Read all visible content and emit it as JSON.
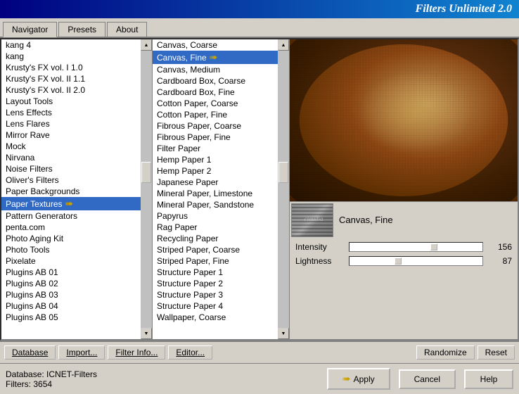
{
  "title": "Filters Unlimited 2.0",
  "tabs": [
    {
      "id": "navigator",
      "label": "Navigator",
      "active": true
    },
    {
      "id": "presets",
      "label": "Presets",
      "active": false
    },
    {
      "id": "about",
      "label": "About",
      "active": false
    }
  ],
  "left_list": {
    "items": [
      "kang 4",
      "kang",
      "Krusty's FX vol. I 1.0",
      "Krusty's FX vol. II 1.1",
      "Krusty's FX vol. II 2.0",
      "Layout Tools",
      "Lens Effects",
      "Lens Flares",
      "Mirror Rave",
      "Mock",
      "Nirvana",
      "Noise Filters",
      "Oliver's Filters",
      "Paper Backgrounds",
      "Paper Textures",
      "Pattern Generators",
      "penta.com",
      "Photo Aging Kit",
      "Photo Tools",
      "Pixelate",
      "Plugins AB 01",
      "Plugins AB 02",
      "Plugins AB 03",
      "Plugins AB 04",
      "Plugins AB 05"
    ],
    "highlighted": "Paper Textures"
  },
  "middle_list": {
    "items": [
      "Canvas, Coarse",
      "Canvas, Fine",
      "Canvas, Medium",
      "Cardboard Box, Coarse",
      "Cardboard Box, Fine",
      "Cotton Paper, Coarse",
      "Cotton Paper, Fine",
      "Fibrous Paper, Coarse",
      "Fibrous Paper, Fine",
      "Filter Paper",
      "Hemp Paper 1",
      "Hemp Paper 2",
      "Japanese Paper",
      "Mineral Paper, Limestone",
      "Mineral Paper, Sandstone",
      "Papyrus",
      "Rag Paper",
      "Recycling Paper",
      "Striped Paper, Coarse",
      "Striped Paper, Fine",
      "Structure Paper 1",
      "Structure Paper 2",
      "Structure Paper 3",
      "Structure Paper 4",
      "Wallpaper, Coarse"
    ],
    "selected": "Canvas, Fine"
  },
  "filter_name": "Canvas, Fine",
  "sliders": [
    {
      "label": "Intensity",
      "value": 156,
      "max": 255,
      "pct": 61
    },
    {
      "label": "Lightness",
      "value": 87,
      "max": 255,
      "pct": 34
    }
  ],
  "toolbar": {
    "database": "Database",
    "import": "Import...",
    "filter_info": "Filter Info...",
    "editor": "Editor...",
    "randomize": "Randomize",
    "reset": "Reset"
  },
  "status": {
    "database_label": "Database:",
    "database_value": "ICNET-Filters",
    "filters_label": "Filters:",
    "filters_value": "3654"
  },
  "actions": {
    "apply": "Apply",
    "cancel": "Cancel",
    "help": "Help"
  }
}
